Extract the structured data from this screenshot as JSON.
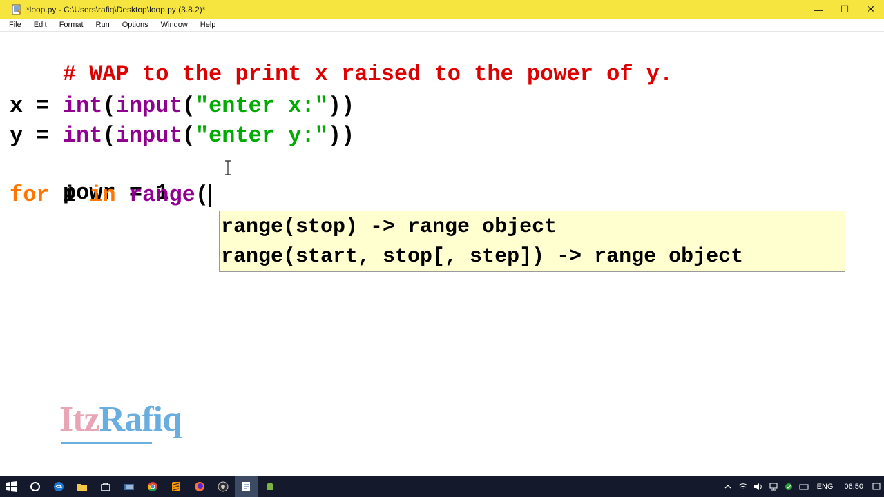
{
  "window": {
    "title": "*loop.py - C:\\Users\\rafiq\\Desktop\\loop.py (3.8.2)*",
    "controls": {
      "minimize": "—",
      "maximize": "☐",
      "close": "✕"
    }
  },
  "menu": [
    "File",
    "Edit",
    "Format",
    "Run",
    "Options",
    "Window",
    "Help"
  ],
  "editor": {
    "comment": "# WAP to the print x raised to the power of y.",
    "line_x": {
      "var": "x = ",
      "int": "int",
      "p1": "(",
      "input": "input",
      "p2": "(",
      "str": "\"enter x:\"",
      "close": "))"
    },
    "line_y": {
      "var": "y = ",
      "int": "int",
      "p1": "(",
      "input": "input",
      "p2": "(",
      "str": "\"enter y:\"",
      "close": "))"
    },
    "line_powr": "powr = 1",
    "line_for": {
      "for": "for",
      "mid1": " i ",
      "in": "in",
      "mid2": " ",
      "range": "range",
      "paren": "("
    }
  },
  "calltip": {
    "line1": "range(stop) -> range object",
    "line2": "range(start, stop[, step]) -> range object"
  },
  "watermark": {
    "part1": "Itz",
    "part2": "Rafiq"
  },
  "taskbar": {
    "icons": [
      "windows-start-icon",
      "cortana-search-icon",
      "edge-browser-icon",
      "file-explorer-icon",
      "store-icon",
      "keyboard-app-icon",
      "chrome-icon",
      "sublime-icon",
      "firefox-icon",
      "obs-icon",
      "python-idle-icon",
      "android-icon"
    ],
    "language": "ENG",
    "time": "06:50"
  },
  "colors": {
    "titlebar": "#f6e53f",
    "keyword": "#ff7700",
    "builtin": "#900090",
    "string": "#00aa00",
    "comment": "#dd0000",
    "calltip_bg": "#ffffd0",
    "taskbar": "#141a2b"
  }
}
